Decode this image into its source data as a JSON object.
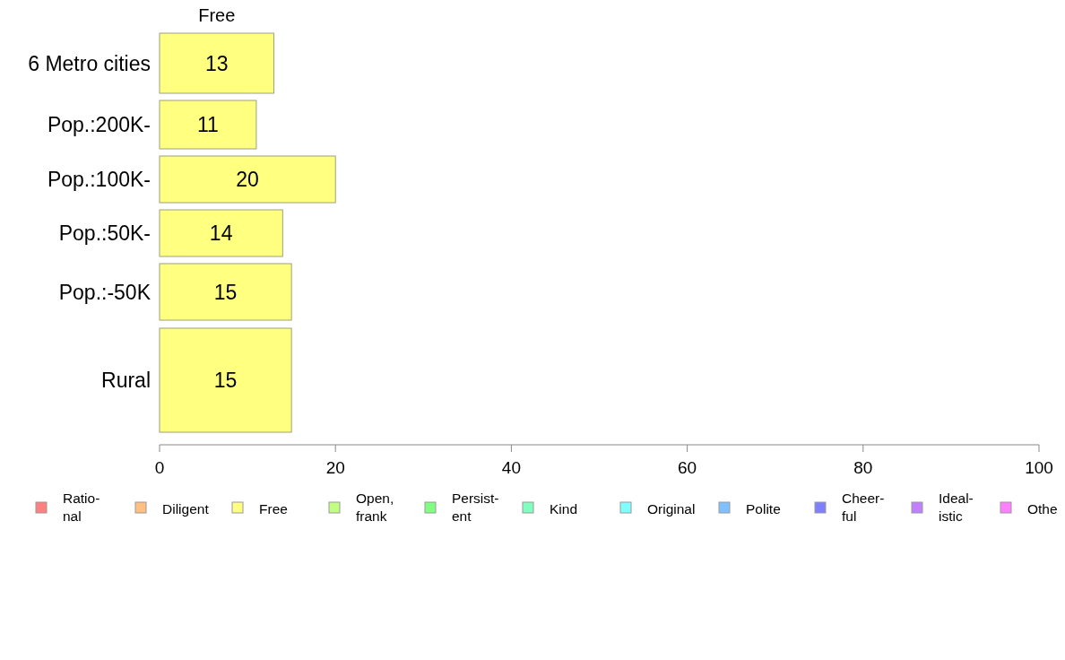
{
  "chart": {
    "chart_data": {
      "type": "bar",
      "orientation": "horizontal",
      "categories": [
        "6 Metro cities",
        "Pop.:200K-",
        "Pop.:100K-",
        "Pop.:50K-",
        "Pop.:-50K",
        "Rural"
      ],
      "series": [
        {
          "name": "Free",
          "color": "#ffff80",
          "values": [
            13,
            11,
            20,
            14,
            15,
            15
          ]
        }
      ],
      "xlim": [
        0,
        100
      ],
      "xticks": [
        0,
        20,
        40,
        60,
        80,
        100
      ],
      "data_labels": true
    },
    "legend": [
      {
        "label": "Ratio-\nnal",
        "color": "#ff8080"
      },
      {
        "label": "Diligent",
        "color": "#ffc080"
      },
      {
        "label": "Free",
        "color": "#ffff80"
      },
      {
        "label": "Open,\nfrank",
        "color": "#c0ff80"
      },
      {
        "label": "Persist-\nent",
        "color": "#80ff80"
      },
      {
        "label": "Kind",
        "color": "#80ffc0"
      },
      {
        "label": "Original",
        "color": "#80ffff"
      },
      {
        "label": "Polite",
        "color": "#80c0ff"
      },
      {
        "label": "Cheer-\nful",
        "color": "#8080ff"
      },
      {
        "label": "Ideal-\nistic",
        "color": "#c080ff"
      },
      {
        "label": "Othe",
        "color": "#ff80ff"
      }
    ]
  }
}
